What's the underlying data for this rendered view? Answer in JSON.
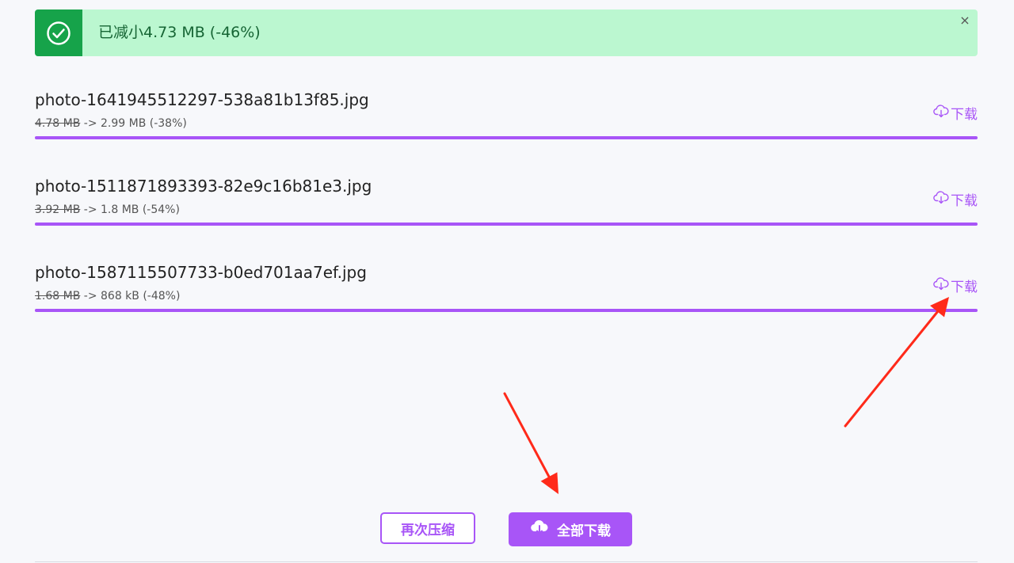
{
  "banner": {
    "message": "已减小4.73 MB (-46%)",
    "close": "×",
    "icon": "check-circle-icon"
  },
  "files": [
    {
      "name": "photo-1641945512297-538a81b13f85.jpg",
      "old_size": "4.78 MB",
      "new_size": "-> 2.99 MB (-38%)",
      "download_label": "下载",
      "progress": 1.0
    },
    {
      "name": "photo-1511871893393-82e9c16b81e3.jpg",
      "old_size": "3.92 MB",
      "new_size": "-> 1.8 MB (-54%)",
      "download_label": "下载",
      "progress": 1.0
    },
    {
      "name": "photo-1587115507733-b0ed701aa7ef.jpg",
      "old_size": "1.68 MB",
      "new_size": "-> 868 kB (-48%)",
      "download_label": "下载",
      "progress": 1.0
    }
  ],
  "actions": {
    "compress_again": "再次压缩",
    "download_all": "全部下载"
  },
  "colors": {
    "accent": "#a855f7",
    "success": "#16a34a",
    "success_bg": "#bbf7d0",
    "annotation": "#ff2a1a"
  }
}
